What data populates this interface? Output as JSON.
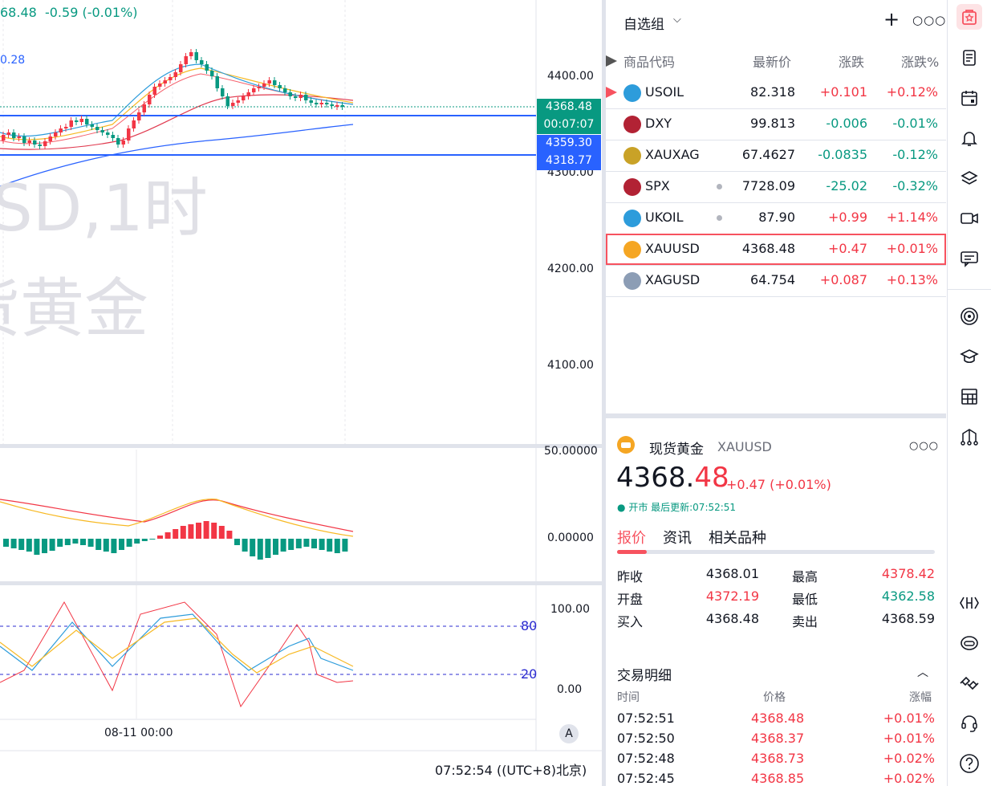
{
  "chart": {
    "legend_line": "68.48  -0.59 (-0.01%)",
    "legend_line2": "0.28",
    "watermark_symbol": "SD,1时",
    "watermark_name": "货黄金",
    "price_ticks": [
      "4400.00",
      "4300.00",
      "4200.00",
      "4100.00"
    ],
    "price_badges": {
      "last": "4368.48",
      "countdown": "00:07:07",
      "line1": "4359.30",
      "line2": "4318.77"
    },
    "macd_ticks": [
      "50.00000",
      "0.00000"
    ],
    "stoch_ticks": [
      "100.00",
      "0.00"
    ],
    "stoch_levels": [
      "80",
      "20"
    ],
    "time_label": "08-11 00:00",
    "auto_button": "A",
    "clock": "07:52:54 ((UTC+8)北京)"
  },
  "watchlist": {
    "title": "自选组",
    "columns": {
      "symbol": "商品代码",
      "last": "最新价",
      "change": "涨跌",
      "percent": "涨跌%"
    },
    "rows": [
      {
        "symbol": "USOIL",
        "last": "82.318",
        "change": "+0.101",
        "percent": "+0.12%",
        "dir": "up",
        "icon": "oil-icon",
        "flag": true
      },
      {
        "symbol": "DXY",
        "last": "99.813",
        "change": "-0.006",
        "percent": "-0.01%",
        "dir": "down",
        "icon": "us-flag-icon"
      },
      {
        "symbol": "XAUXAG",
        "last": "67.4627",
        "change": "-0.0835",
        "percent": "-0.12%",
        "dir": "down",
        "icon": "gold-silver-icon"
      },
      {
        "symbol": "SPX",
        "last": "7728.09",
        "change": "-25.02",
        "percent": "-0.32%",
        "dir": "down",
        "icon": "us-flag-icon",
        "dot": true
      },
      {
        "symbol": "UKOIL",
        "last": "87.90",
        "change": "+0.99",
        "percent": "+1.14%",
        "dir": "up",
        "icon": "oil-icon",
        "dot": true
      },
      {
        "symbol": "XAUUSD",
        "last": "4368.48",
        "change": "+0.47",
        "percent": "+0.01%",
        "dir": "up",
        "icon": "gold-icon",
        "selected": true
      },
      {
        "symbol": "XAGUSD",
        "last": "64.754",
        "change": "+0.087",
        "percent": "+0.13%",
        "dir": "up",
        "icon": "silver-icon"
      }
    ]
  },
  "details": {
    "name": "现货黄金",
    "symbol": "XAUUSD",
    "price_main": "4368.",
    "price_frac": "48",
    "change": "+0.47 (+0.01%)",
    "status": "开市 最后更新:07:52:51",
    "tabs": [
      "报价",
      "资讯",
      "相关品种"
    ],
    "stats": [
      {
        "label": "昨收",
        "value": "4368.01",
        "dir": "neutral"
      },
      {
        "label": "最高",
        "value": "4378.42",
        "dir": "up"
      },
      {
        "label": "开盘",
        "value": "4372.19",
        "dir": "up"
      },
      {
        "label": "最低",
        "value": "4362.58",
        "dir": "down"
      },
      {
        "label": "买入",
        "value": "4368.48",
        "dir": "neutral"
      },
      {
        "label": "卖出",
        "value": "4368.59",
        "dir": "neutral"
      }
    ],
    "trades_title": "交易明细",
    "trades_cols": [
      "时间",
      "价格",
      "涨幅"
    ],
    "trades": [
      {
        "time": "07:52:51",
        "price": "4368.48",
        "pct": "+0.01%"
      },
      {
        "time": "07:52:50",
        "price": "4368.37",
        "pct": "+0.01%"
      },
      {
        "time": "07:52:48",
        "price": "4368.73",
        "pct": "+0.02%"
      },
      {
        "time": "07:52:45",
        "price": "4368.85",
        "pct": "+0.02%"
      }
    ]
  },
  "rail": [
    "watchlist-icon",
    "news-icon",
    "calendar-icon",
    "alerts-icon",
    "layers-icon",
    "video-icon",
    "chat-icon",
    "target-icon",
    "education-icon",
    "screener-icon",
    "strategy-icon",
    "api-icon",
    "robot-icon",
    "handshake-icon",
    "support-icon",
    "help-icon"
  ],
  "colors": {
    "up": "#f23645",
    "down": "#089981",
    "accent": "#f7525f",
    "blue_line": "#2962ff"
  }
}
